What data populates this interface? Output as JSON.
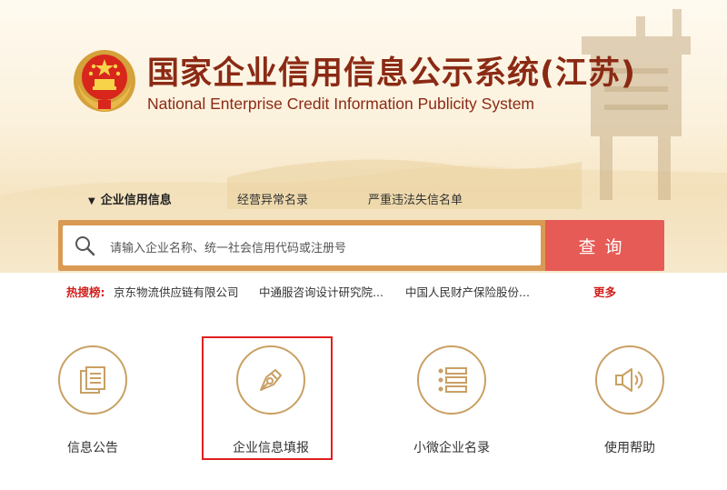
{
  "header": {
    "title_cn": "国家企业信用信息公示系统(江苏)",
    "title_en": "National Enterprise Credit Information Publicity System"
  },
  "tabs": [
    {
      "label": "企业信用信息",
      "active": true
    },
    {
      "label": "经营异常名录",
      "active": false
    },
    {
      "label": "严重违法失信名单",
      "active": false
    }
  ],
  "search": {
    "placeholder": "请输入企业名称、统一社会信用代码或注册号",
    "button_label": "查询"
  },
  "hot_search": {
    "label": "热搜榜:",
    "items": [
      "京东物流供应链有限公司",
      "中通服咨询设计研究院...",
      "中国人民财产保险股份..."
    ],
    "more_label": "更多"
  },
  "features": [
    {
      "label": "信息公告",
      "icon": "document-icon"
    },
    {
      "label": "企业信息填报",
      "icon": "pen-icon",
      "highlighted": true
    },
    {
      "label": "小微企业名录",
      "icon": "list-icon"
    },
    {
      "label": "使用帮助",
      "icon": "speaker-icon"
    }
  ],
  "colors": {
    "brand_red": "#8b2a14",
    "search_button": "#e65b55",
    "search_frame": "#d99a54",
    "icon_gold": "#c9a064",
    "highlight_red": "#e02020"
  }
}
